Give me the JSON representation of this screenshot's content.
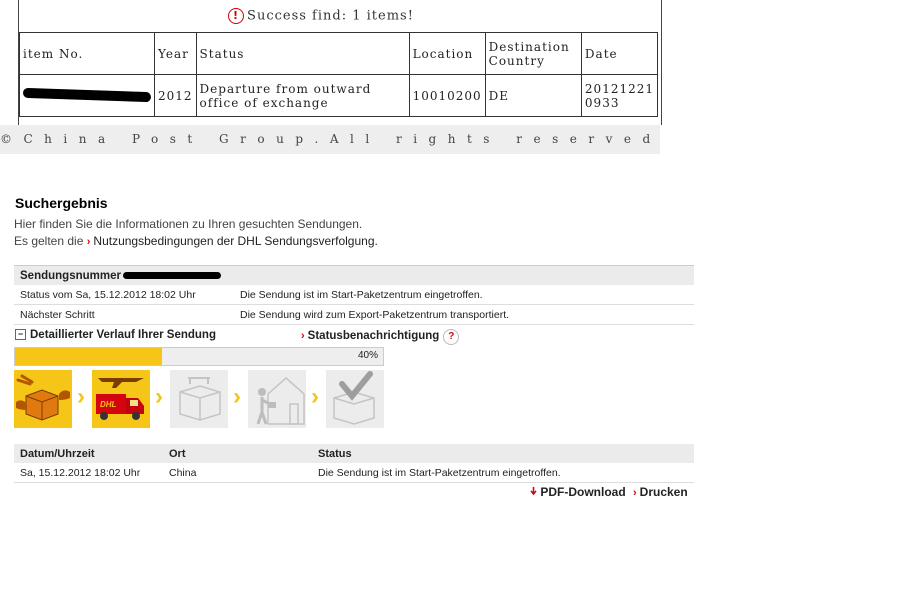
{
  "chinapost": {
    "success_icon": "warning-circle-icon",
    "success_text": "Success find: 1 items!",
    "columns": [
      "item No.",
      "Year",
      "Status",
      "Location",
      "Destination Country",
      "Date"
    ],
    "row": {
      "item_no": "",
      "year": "2012",
      "status": "Departure from outward office of exchange",
      "location": "10010200",
      "destination": "DE",
      "date": "20121221 0933"
    },
    "footer": "©China Post Group.All rights reserved"
  },
  "dhl": {
    "title": "Suchergebnis",
    "intro_line1": "Hier finden Sie die Informationen zu Ihren gesuchten Sendungen.",
    "intro_line2_prefix": "Es gelten die",
    "intro_line2_link": "Nutzungsbedingungen der DHL Sendungsverfolgung.",
    "summary": {
      "header_label": "Sendungsnummer",
      "rows": [
        {
          "label": "Status vom Sa, 15.12.2012 18:02 Uhr",
          "value": "Die Sendung ist im Start-Paketzentrum eingetroffen."
        },
        {
          "label": "Nächster Schritt",
          "value": "Die Sendung wird zum Export-Paketzentrum transportiert."
        }
      ]
    },
    "detail_toggle_icon": "minus",
    "detail_toggle_label": "Detaillierter Verlauf Ihrer Sendung",
    "status_notify_label": "Statusbenachrichtigung",
    "status_notify_help": "?",
    "progress": {
      "label": "40%",
      "fraction": 0.4
    },
    "steps": [
      {
        "icon": "package-handover-icon",
        "active": true
      },
      {
        "icon": "truck-plane-icon",
        "active": true
      },
      {
        "icon": "sorting-center-icon",
        "active": false
      },
      {
        "icon": "delivery-house-icon",
        "active": false
      },
      {
        "icon": "delivered-check-icon",
        "active": false
      }
    ],
    "history": {
      "columns": [
        "Datum/Uhrzeit",
        "Ort",
        "Status"
      ],
      "rows": [
        {
          "datetime": "Sa, 15.12.2012 18:02 Uhr",
          "place": "China",
          "status": "Die Sendung ist im Start-Paketzentrum eingetroffen."
        }
      ]
    },
    "pdf_label": "PDF-Download",
    "print_label": "Drucken",
    "colors": {
      "accent": "#f5c518",
      "red": "#d40511"
    }
  }
}
